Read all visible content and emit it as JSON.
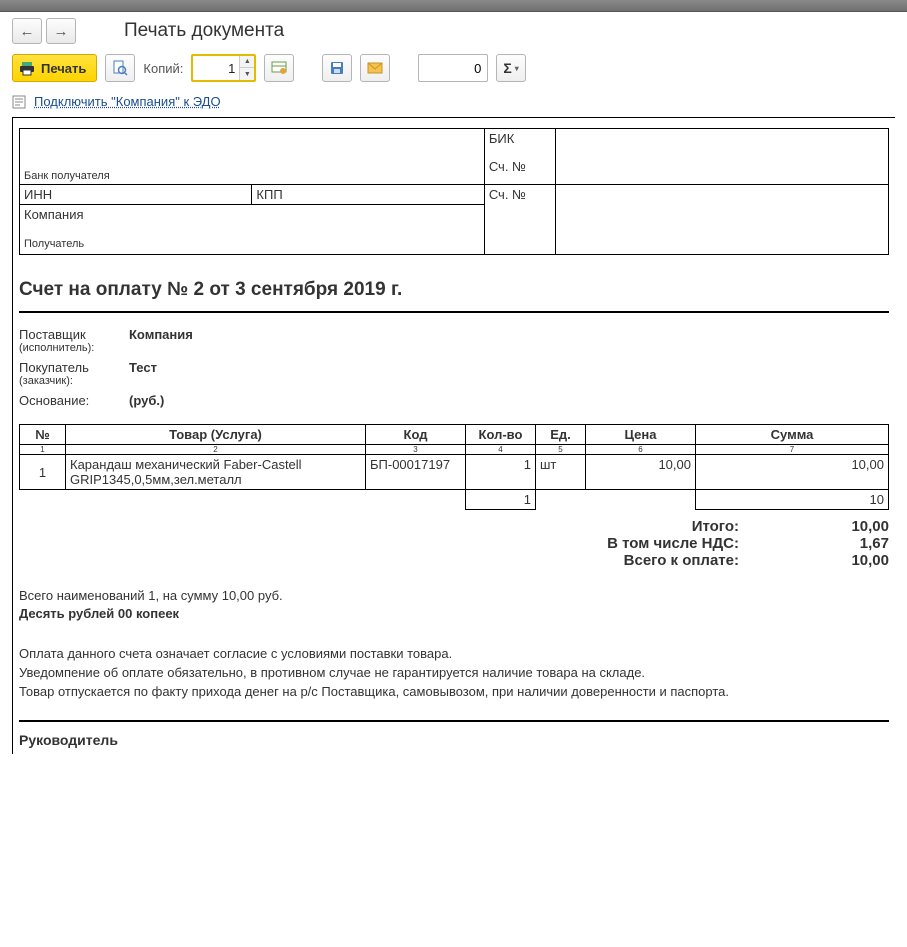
{
  "header": {
    "title": "Печать документа"
  },
  "toolbar": {
    "print_label": "Печать",
    "copies_label": "Копий:",
    "copies_value": "1",
    "num_value": "0",
    "sigma_label": "Σ"
  },
  "link": {
    "text": "Подключить \"Компания\" к ЭДО"
  },
  "bank": {
    "recipient_bank_label": "Банк получателя",
    "bik_label": "БИК",
    "acc1_label": "Сч. №",
    "inn_label": "ИНН",
    "kpp_label": "КПП",
    "acc2_label": "Сч. №",
    "company": "Компания",
    "recipient_label": "Получатель"
  },
  "invoice": {
    "title": "Счет на оплату № 2 от 3 сентября 2019 г.",
    "supplier_label": "Поставщик",
    "supplier_sub": "(исполнитель):",
    "supplier_value": "Компания",
    "buyer_label": "Покупатель",
    "buyer_sub": "(заказчик):",
    "buyer_value": "Тест",
    "basis_label": "Основание:",
    "basis_value": "(руб.)"
  },
  "items": {
    "headers": {
      "num": "№",
      "product": "Товар (Услуга)",
      "code": "Код",
      "qty": "Кол-во",
      "unit": "Ед.",
      "price": "Цена",
      "sum": "Сумма"
    },
    "subhead": [
      "1",
      "2",
      "3",
      "4",
      "5",
      "6",
      "7"
    ],
    "rows": [
      {
        "num": "1",
        "product": "Карандаш механический Faber-Castell GRIP1345,0,5мм,зел.металл",
        "code": "БП-00017197",
        "qty": "1",
        "unit": "шт",
        "price": "10,00",
        "sum": "10,00"
      }
    ],
    "footer": {
      "qty_total": "1",
      "sum_total": "10"
    }
  },
  "totals": {
    "itogo_label": "Итого:",
    "itogo_value": "10,00",
    "nds_label": "В том числе НДС:",
    "nds_value": "1,67",
    "total_label": "Всего к оплате:",
    "total_value": "10,00"
  },
  "summary": {
    "line1": "Всего наименований 1, на сумму 10,00 руб.",
    "line2": "Десять рублей 00 копеек"
  },
  "fineprint": {
    "l1": "Оплата данного счета означает согласие с условиями поставки товара.",
    "l2": "Уведомпение об оплате обязательно, в противном случае не гарантируется наличие товара на складе.",
    "l3": "Товар отпускается по факту прихода денег на р/с Поставщика, самовывозом, при наличии доверенности и паспорта."
  },
  "signature": {
    "director": "Руководитель"
  }
}
